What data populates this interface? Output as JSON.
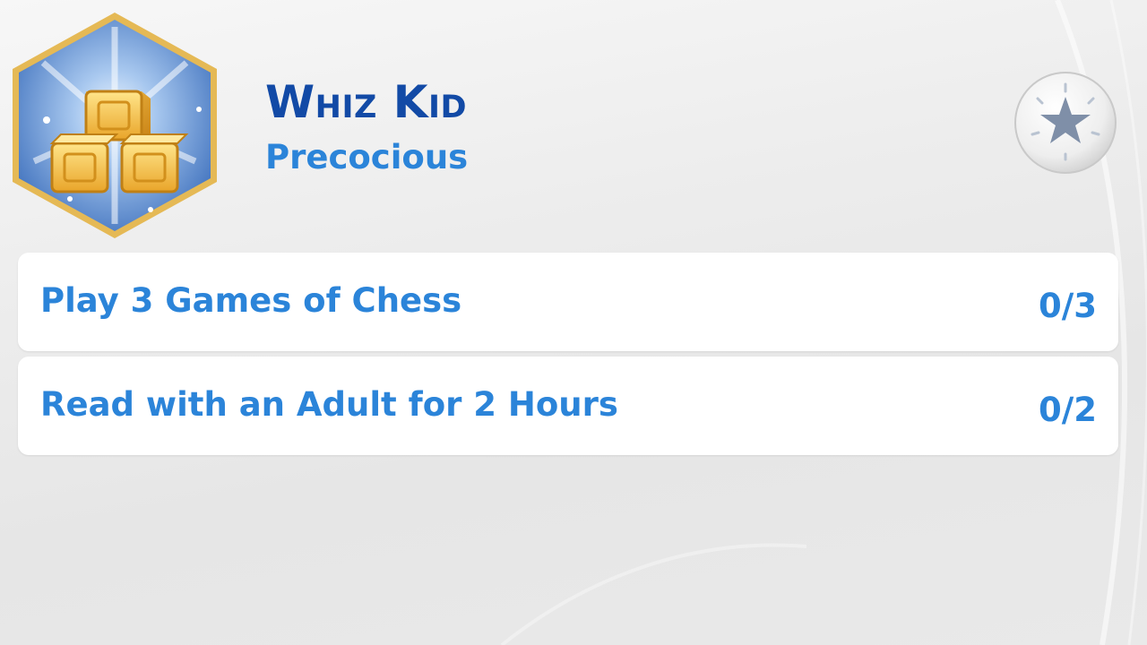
{
  "aspiration": {
    "icon": "golden-blocks-hexagon-icon",
    "title": "Whiz Kid",
    "category": "Precocious"
  },
  "favorite_button": {
    "icon": "star-icon"
  },
  "goals": [
    {
      "label": "Play 3 Games of Chess",
      "progress_text": "0/3",
      "current": 0,
      "total": 3
    },
    {
      "label": "Read with an Adult for 2 Hours",
      "progress_text": "0/2",
      "current": 0,
      "total": 2
    }
  ],
  "colors": {
    "title": "#124aa6",
    "text": "#2b84d9",
    "badge_border": "#e2b64e",
    "badge_fill": "#5d8fd0"
  }
}
